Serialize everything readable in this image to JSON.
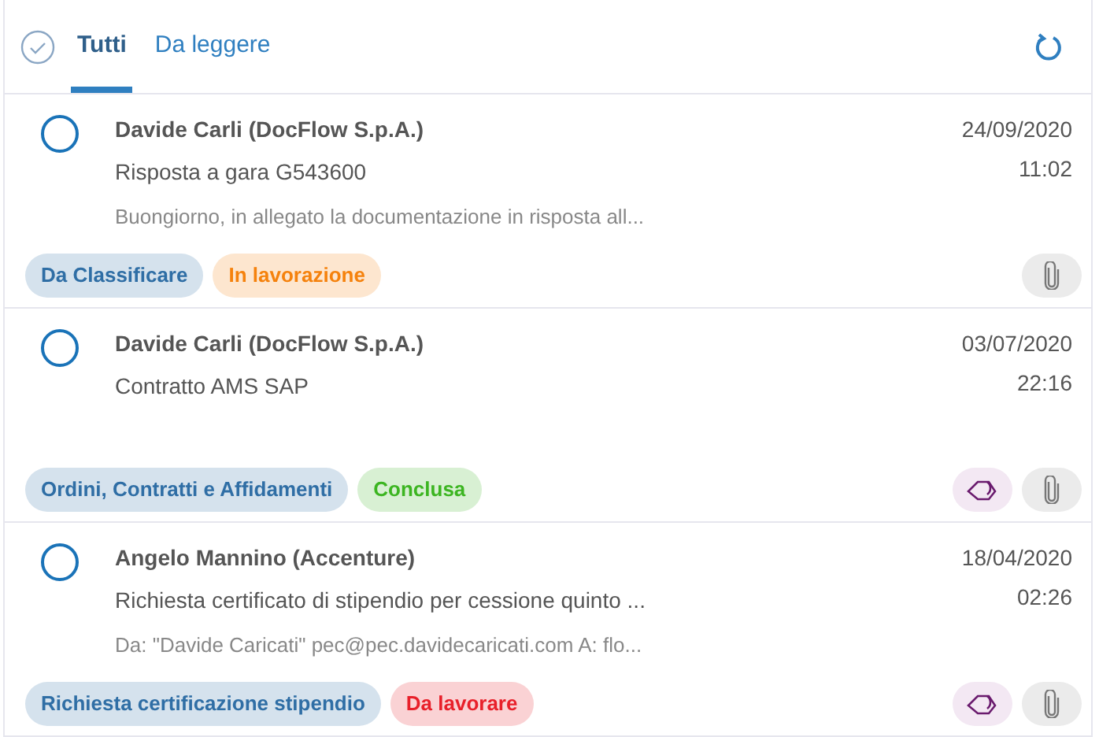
{
  "tabs": [
    {
      "label": "Tutti",
      "selected": true
    },
    {
      "label": "Da leggere",
      "selected": false
    }
  ],
  "messages": [
    {
      "selected": false,
      "sender": "Davide Carli (DocFlow S.p.A.)",
      "subject": "Risposta a gara G543600",
      "preview": "Buongiorno, in allegato la documentazione in risposta all...",
      "date": "24/09/2020",
      "time": "11:02",
      "tags": [
        {
          "label": "Da Classificare",
          "color": "#2f6ea5"
        },
        {
          "label": "In lavorazione",
          "color": "#f5820d"
        }
      ],
      "label_button": false,
      "attachment": true
    },
    {
      "selected": false,
      "sender": "Davide Carli (DocFlow S.p.A.)",
      "subject": "Contratto AMS SAP",
      "date": "03/07/2020",
      "time": "22:16",
      "tags": [
        {
          "label": "Ordini, Contratti e Affidamenti",
          "color": "#2f6ea5"
        },
        {
          "label": "Conclusa",
          "color": "#3cb521"
        }
      ],
      "label_button": true,
      "attachment": true
    },
    {
      "selected": false,
      "sender": "Angelo Mannino (Accenture)",
      "subject": "Richiesta certificato di stipendio per cessione quinto ...",
      "preview": "Da: \"Davide Caricati\" pec@pec.davidecaricati.com A: flo...",
      "date": "18/04/2020",
      "time": "02:26",
      "tags": [
        {
          "label": "Richiesta certificazione stipendio",
          "color": "#2f6ea5"
        },
        {
          "label": "Da lavorare",
          "color": "#e8202a"
        }
      ],
      "label_button": true,
      "attachment": true
    }
  ]
}
